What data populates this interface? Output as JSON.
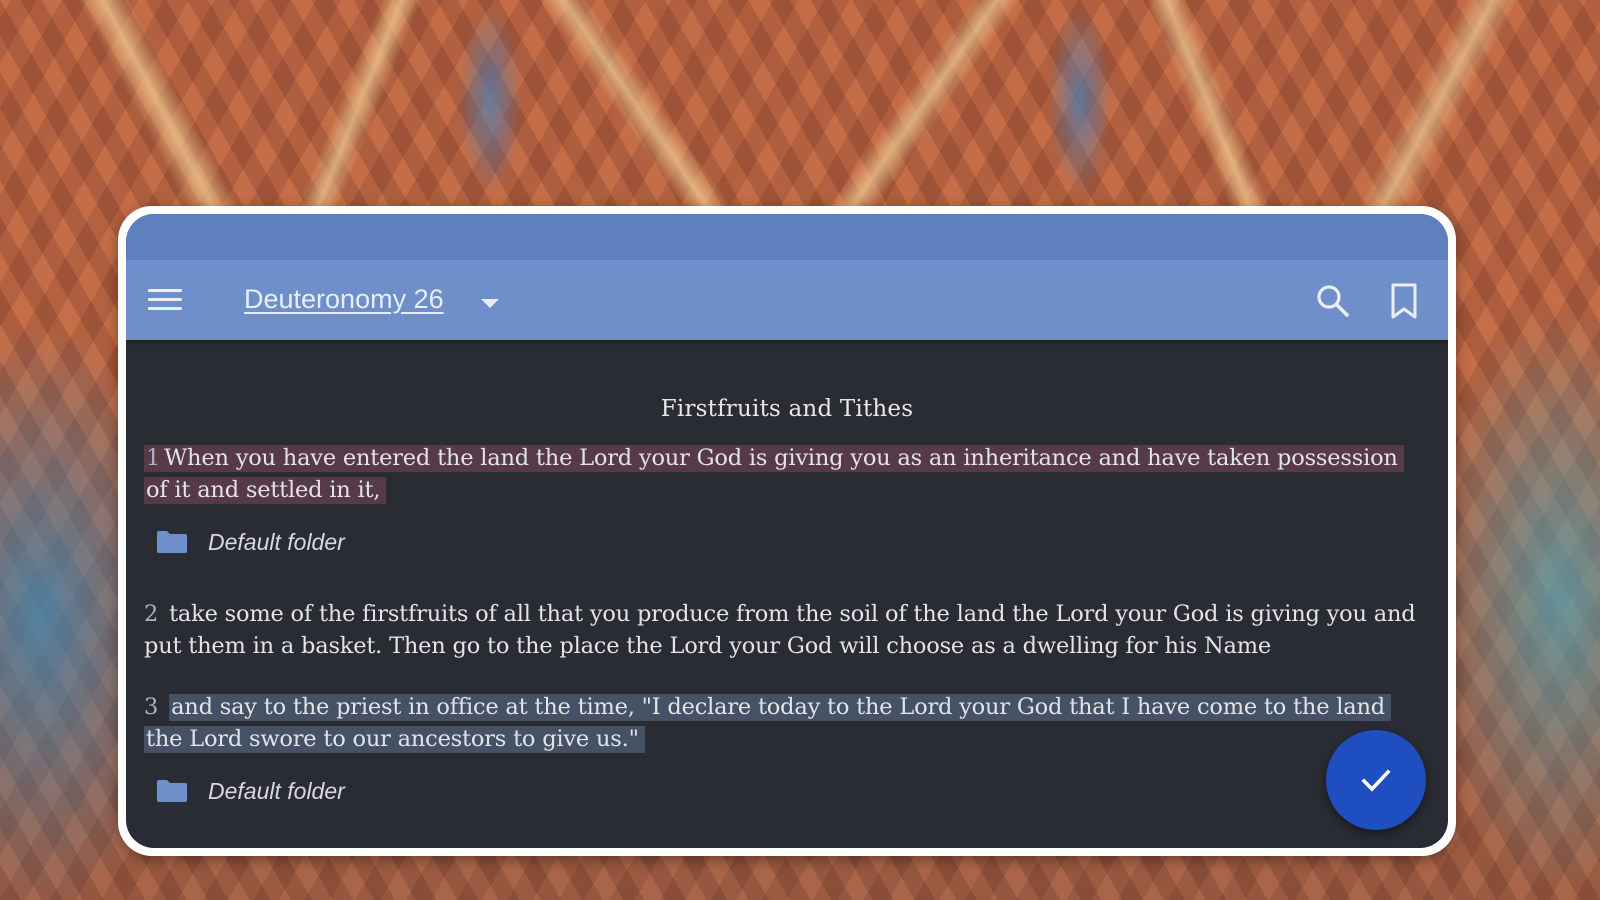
{
  "toolbar": {
    "title": "Deuteronomy 26"
  },
  "passage": {
    "heading": "Firstfruits and Tithes",
    "verses": [
      {
        "number": "1",
        "text": "When you have entered the land the Lord your God is giving you as an inheritance and have taken possession of it and settled in it,",
        "highlight": "#96506a",
        "folder": "Default folder"
      },
      {
        "number": "2",
        "text": "take some of the firstfruits of all that you produce from the soil of the land the Lord your God is giving you and put them in a basket. Then go to the place the Lord your God will choose as a dwelling for his Name"
      },
      {
        "number": "3",
        "text": "and say to the priest in office at the time, \"I declare today to the Lord your God that I have come to the land the Lord swore to our ancestors to give us.\"",
        "highlight": "#6e87af",
        "folder": "Default folder"
      }
    ]
  },
  "icons": {
    "menu": "menu-icon",
    "dropdown": "chevron-down-icon",
    "search": "search-icon",
    "bookmark": "bookmark-icon",
    "folder": "folder-icon",
    "confirm": "checkmark-icon"
  },
  "colors": {
    "status_bar": "#5f80be",
    "toolbar": "#6e8fca",
    "content_bg": "#292c33",
    "fab": "#1f4ec0",
    "folder_icon": "#6e8fca"
  }
}
